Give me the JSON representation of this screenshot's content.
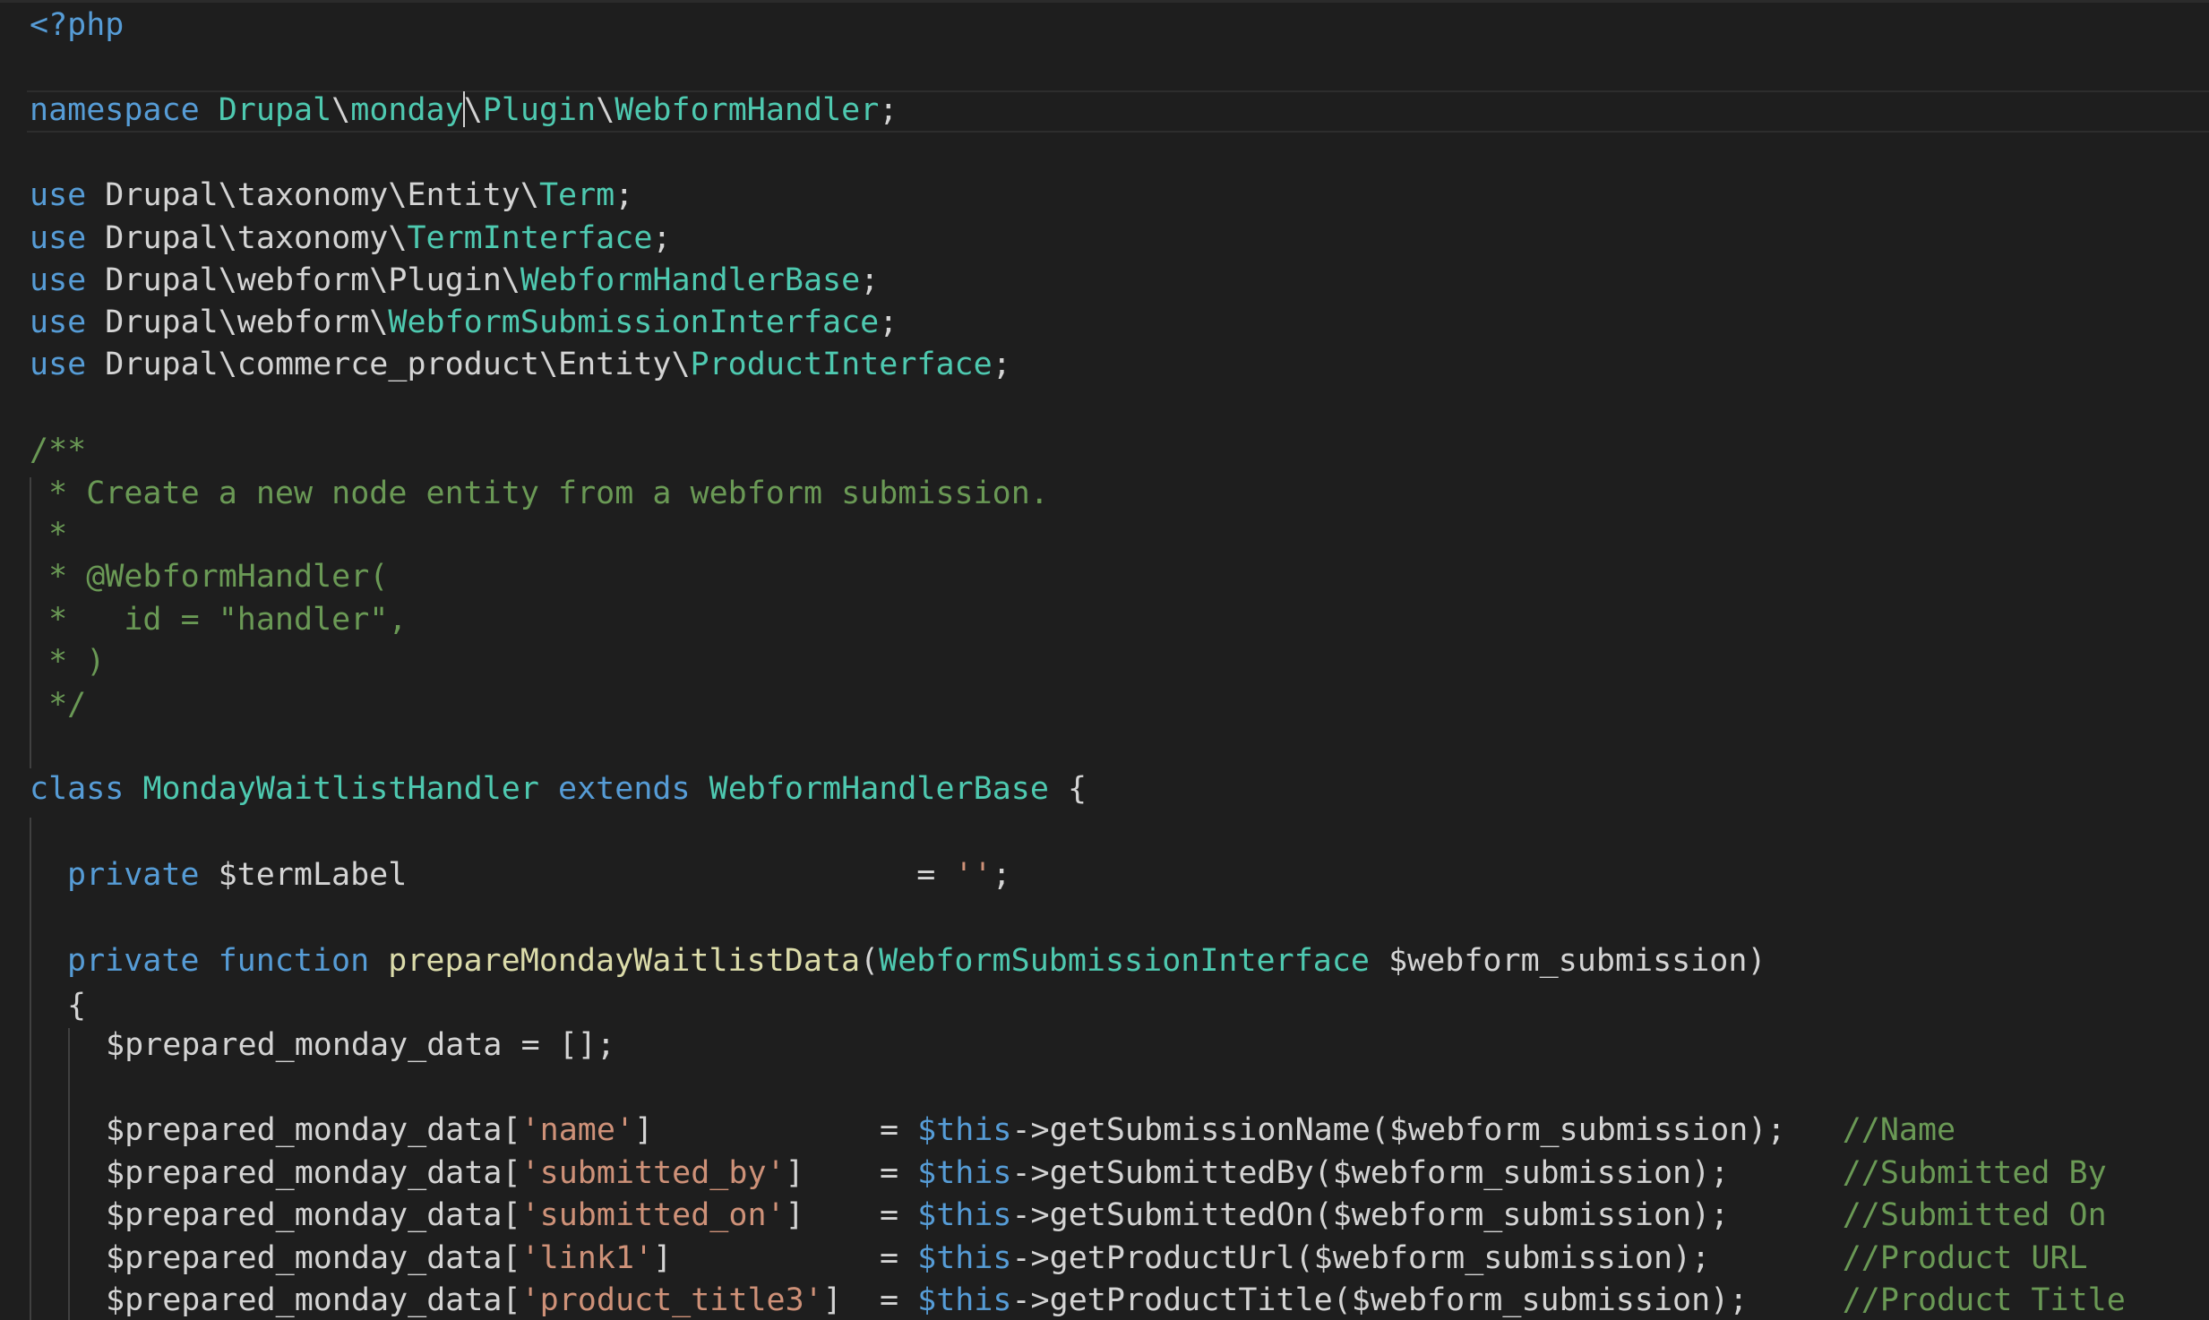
{
  "colors": {
    "background": "#1e1e1e",
    "keyword": "#569cd6",
    "type": "#4ec9b0",
    "function": "#dcdcaa",
    "variable": "#9cdcfe",
    "string": "#ce9178",
    "comment": "#6a9955",
    "plain": "#d4d4d4"
  },
  "code": {
    "php_open": "<?php",
    "kw_namespace": "namespace",
    "ns_drupal": "Drupal",
    "ns_monday": "monday",
    "ns_plugin": "Plugin",
    "ns_handler": "WebformHandler",
    "kw_use": "use",
    "sep": "\\",
    "semi": ";",
    "use1_path": "Drupal\\taxonomy\\Entity\\",
    "use1_class": "Term",
    "use2_path": "Drupal\\taxonomy\\",
    "use2_class": "TermInterface",
    "use3_path": "Drupal\\webform\\Plugin\\",
    "use3_class": "WebformHandlerBase",
    "use4_path": "Drupal\\webform\\",
    "use4_class": "WebformSubmissionInterface",
    "use5_path": "Drupal\\commerce_product\\Entity\\",
    "use5_class": "ProductInterface",
    "doc_open": "/**",
    "doc_line1": " * Create a new node entity from a webform submission.",
    "doc_line2": " *",
    "doc_line3": " * @WebformHandler(",
    "doc_line4": " *   id = \"handler\",",
    "doc_line5": " * )",
    "doc_close": " */",
    "kw_class": "class",
    "class_name": "MondayWaitlistHandler",
    "kw_extends": "extends",
    "base_class": "WebformHandlerBase",
    "open_brace": "{",
    "kw_private": "private",
    "prop_termLabel": "$termLabel",
    "assign_pad_term": "                           = ",
    "empty_string": "''",
    "kw_function": "function",
    "method_name": "prepareMondayWaitlistData",
    "paren_open": "(",
    "param_type": "WebformSubmissionInterface",
    "param_var": "$webform_submission",
    "paren_close": ")",
    "prepared_var": "$prepared_monday_data",
    "assign_empty_array": " = [];",
    "bracket_open": "[",
    "bracket_close": "]",
    "this_var": "$this",
    "arrow": "->",
    "rows": [
      {
        "key": "'name'",
        "pad": "            = ",
        "method": "getSubmissionName",
        "tail": ");   ",
        "comment": "//Name"
      },
      {
        "key": "'submitted_by'",
        "pad": "    = ",
        "method": "getSubmittedBy",
        "tail": ");      ",
        "comment": "//Submitted By"
      },
      {
        "key": "'submitted_on'",
        "pad": "    = ",
        "method": "getSubmittedOn",
        "tail": ");      ",
        "comment": "//Submitted On"
      },
      {
        "key": "'link1'",
        "pad": "           = ",
        "method": "getProductUrl",
        "tail": ");       ",
        "comment": "//Product URL"
      },
      {
        "key": "'product_title3'",
        "pad": "  = ",
        "method": "getProductTitle",
        "tail": ");     ",
        "comment": "//Product Title"
      }
    ]
  }
}
